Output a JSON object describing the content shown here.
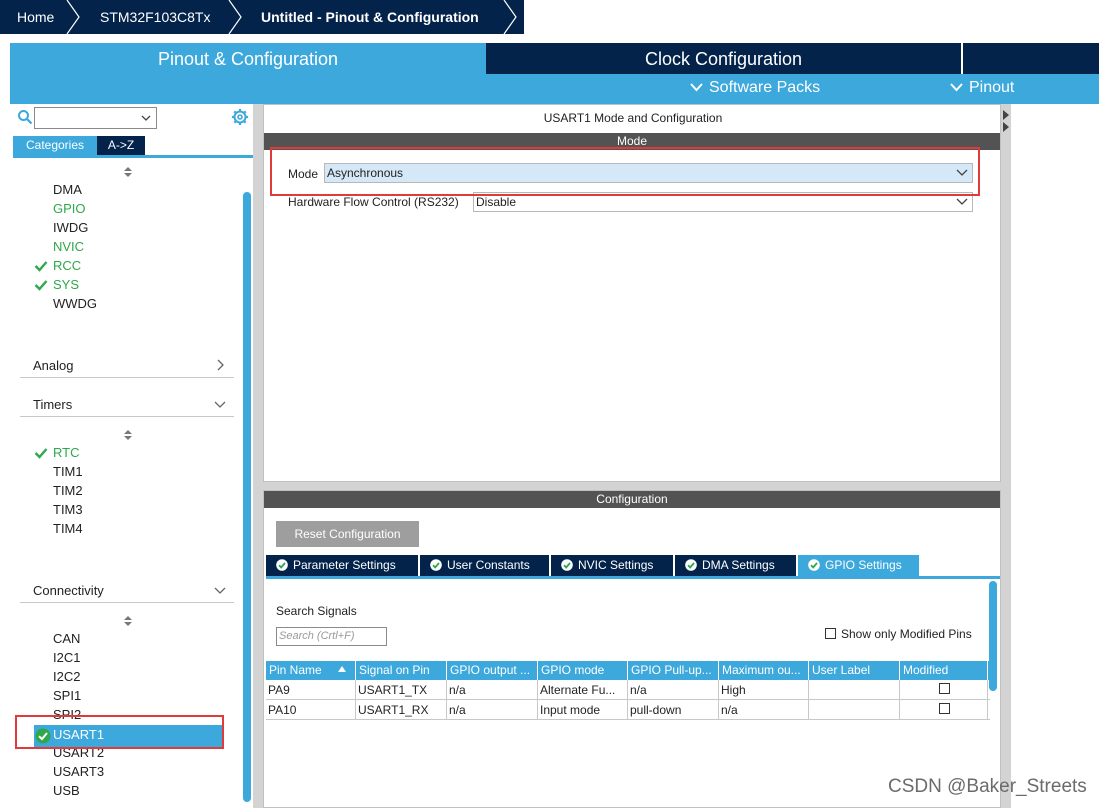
{
  "breadcrumb": {
    "items": [
      "Home",
      "STM32F103C8Tx",
      "Untitled - Pinout & Configuration"
    ]
  },
  "main_tabs": {
    "pinout": "Pinout & Configuration",
    "clock": "Clock Configuration",
    "software_packs": "Software Packs",
    "pinout_menu": "Pinout"
  },
  "left_panel": {
    "search": {
      "value": ""
    },
    "category_tabs": [
      "Categories",
      "A->Z"
    ],
    "system_core_items": [
      {
        "label": "DMA",
        "state": "normal"
      },
      {
        "label": "GPIO",
        "state": "green"
      },
      {
        "label": "IWDG",
        "state": "normal"
      },
      {
        "label": "NVIC",
        "state": "green"
      },
      {
        "label": "RCC",
        "state": "checked"
      },
      {
        "label": "SYS",
        "state": "checked"
      },
      {
        "label": "WWDG",
        "state": "normal"
      }
    ],
    "sections": {
      "analog": "Analog",
      "timers": "Timers",
      "connectivity": "Connectivity"
    },
    "timer_items": [
      {
        "label": "RTC",
        "state": "checked"
      },
      {
        "label": "TIM1",
        "state": "normal"
      },
      {
        "label": "TIM2",
        "state": "normal"
      },
      {
        "label": "TIM3",
        "state": "normal"
      },
      {
        "label": "TIM4",
        "state": "normal"
      }
    ],
    "connectivity_items": [
      {
        "label": "CAN",
        "state": "normal"
      },
      {
        "label": "I2C1",
        "state": "normal"
      },
      {
        "label": "I2C2",
        "state": "normal"
      },
      {
        "label": "SPI1",
        "state": "normal"
      },
      {
        "label": "SPI2",
        "state": "normal"
      },
      {
        "label": "USART1",
        "state": "selected"
      },
      {
        "label": "USART2",
        "state": "normal"
      },
      {
        "label": "USART3",
        "state": "normal"
      },
      {
        "label": "USB",
        "state": "normal"
      }
    ]
  },
  "mode_panel": {
    "title": "USART1 Mode and Configuration",
    "section": "Mode",
    "mode_label": "Mode",
    "mode_value": "Asynchronous",
    "hwflow_label": "Hardware Flow Control (RS232)",
    "hwflow_value": "Disable"
  },
  "config_panel": {
    "section": "Configuration",
    "reset_button": "Reset Configuration",
    "tabs": [
      "Parameter Settings",
      "User Constants",
      "NVIC Settings",
      "DMA Settings",
      "GPIO Settings"
    ],
    "active_tab": "GPIO Settings",
    "search_label": "Search Signals",
    "search_placeholder": "Search (Crtl+F)",
    "show_modified_label": "Show only Modified Pins",
    "table": {
      "headers": [
        "Pin Name",
        "Signal on Pin",
        "GPIO output ...",
        "GPIO mode",
        "GPIO Pull-up...",
        "Maximum ou...",
        "User Label",
        "Modified"
      ],
      "rows": [
        [
          "PA9",
          "USART1_TX",
          "n/a",
          "Alternate Fu...",
          "n/a",
          "High",
          "",
          ""
        ],
        [
          "PA10",
          "USART1_RX",
          "n/a",
          "Input mode",
          "pull-down",
          "n/a",
          "",
          ""
        ]
      ]
    }
  },
  "watermark": "CSDN @Baker_Streets",
  "colors": {
    "navy": "#03234b",
    "accent_blue": "#3ca8dc",
    "green": "#2ea84a",
    "highlight_red": "#e03a3a"
  }
}
